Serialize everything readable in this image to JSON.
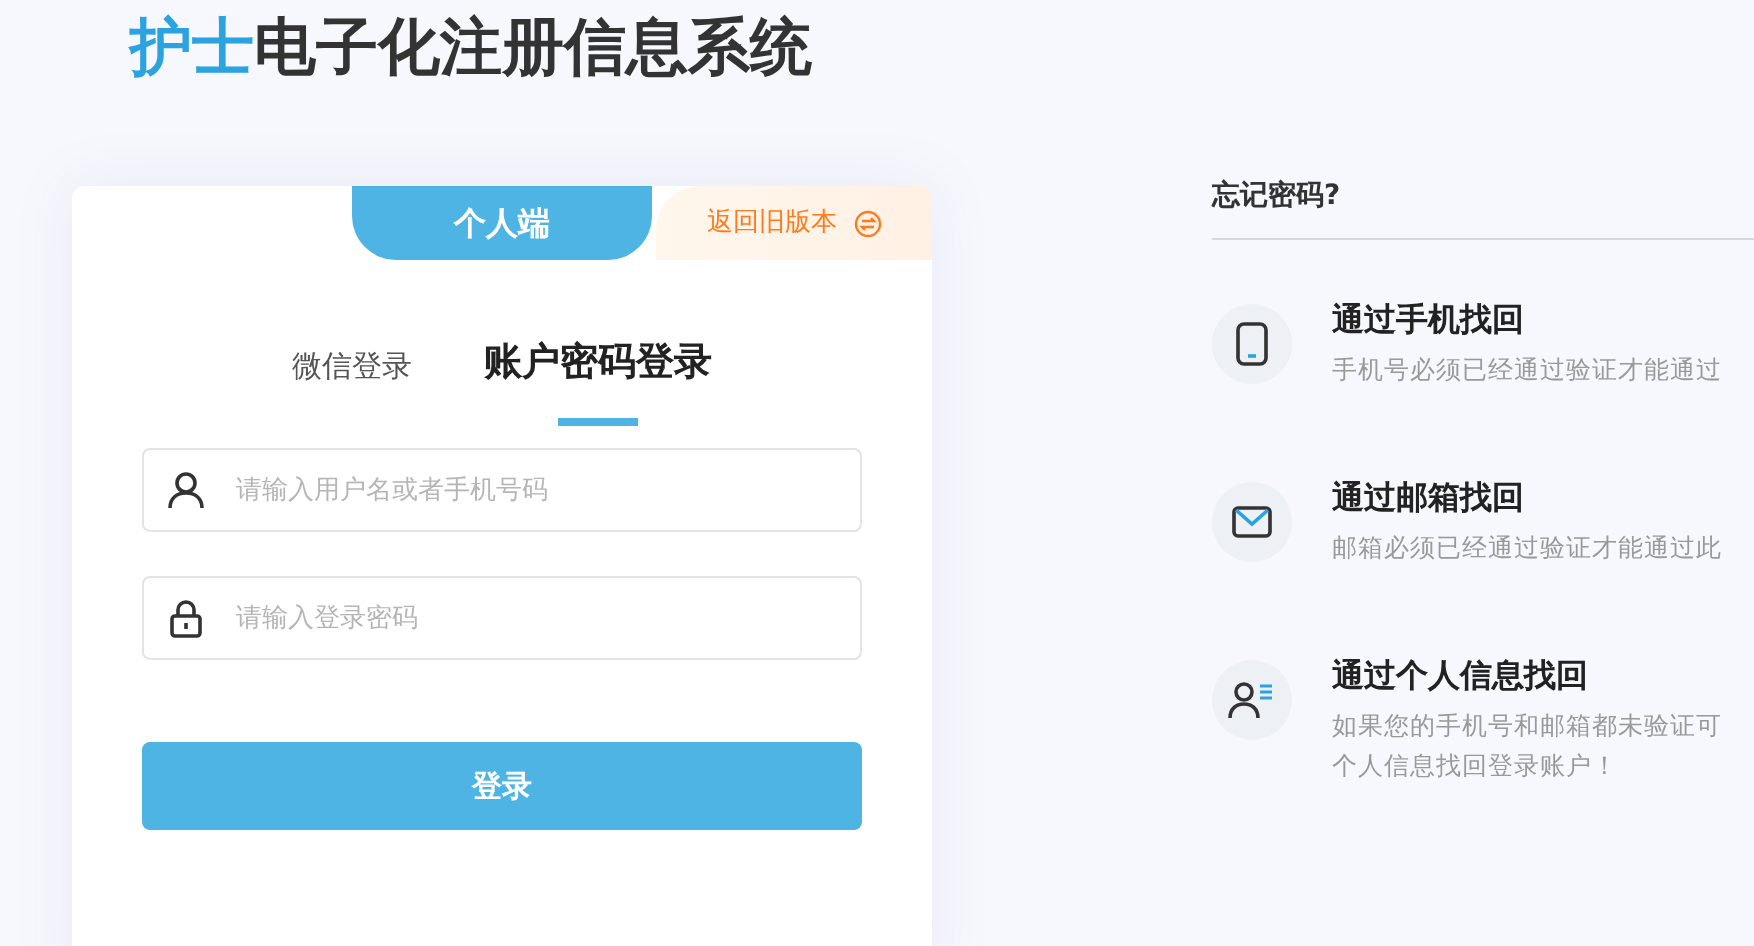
{
  "title": {
    "highlight": "护士",
    "rest": "电子化注册信息系统"
  },
  "card": {
    "portal_tab": "个人端",
    "old_version_link": "返回旧版本",
    "login_tabs": [
      {
        "label": "微信登录",
        "selected": false
      },
      {
        "label": "账户密码登录",
        "selected": true
      }
    ],
    "fields": [
      {
        "kind": "user",
        "placeholder": "请输入用户名或者手机号码"
      },
      {
        "kind": "password",
        "placeholder": "请输入登录密码"
      }
    ],
    "submit": "登录"
  },
  "forgot": {
    "heading": "忘记密码?",
    "options": [
      {
        "kind": "phone",
        "title": "通过手机找回",
        "lines": [
          "手机号必须已经通过验证才能通过"
        ]
      },
      {
        "kind": "email",
        "title": "通过邮箱找回",
        "lines": [
          "邮箱必须已经通过验证才能通过此"
        ]
      },
      {
        "kind": "person",
        "title": "通过个人信息找回",
        "lines": [
          "如果您的手机号和邮箱都未验证可",
          "个人信息找回登录账户！"
        ]
      }
    ]
  }
}
